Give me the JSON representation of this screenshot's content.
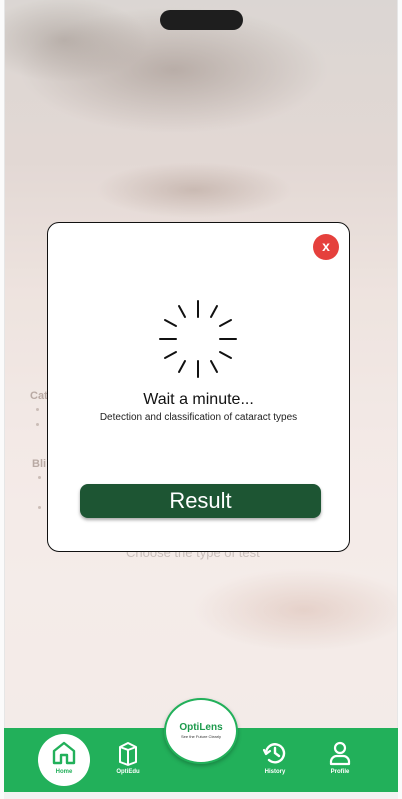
{
  "background": {
    "section_cataract": "Cat",
    "section_blindness": "Bli",
    "choose_text": "Choose the type of test"
  },
  "modal": {
    "close_label": "x",
    "title": "Wait a minute...",
    "subtitle": "Detection and classification of cataract types",
    "result_button": "Result"
  },
  "nav": {
    "home": "Home",
    "optiedu": "OptiEdu",
    "history": "History",
    "profile": "Profile",
    "brand_name": "OptiLens",
    "brand_tagline": "See the Future Clearly"
  },
  "colors": {
    "brand_green": "#22b05a",
    "result_button": "#1d5533",
    "close_button": "#e5403c"
  },
  "icons": [
    "home-icon",
    "book-icon",
    "history-icon",
    "profile-icon",
    "spinner-icon",
    "close-icon"
  ]
}
